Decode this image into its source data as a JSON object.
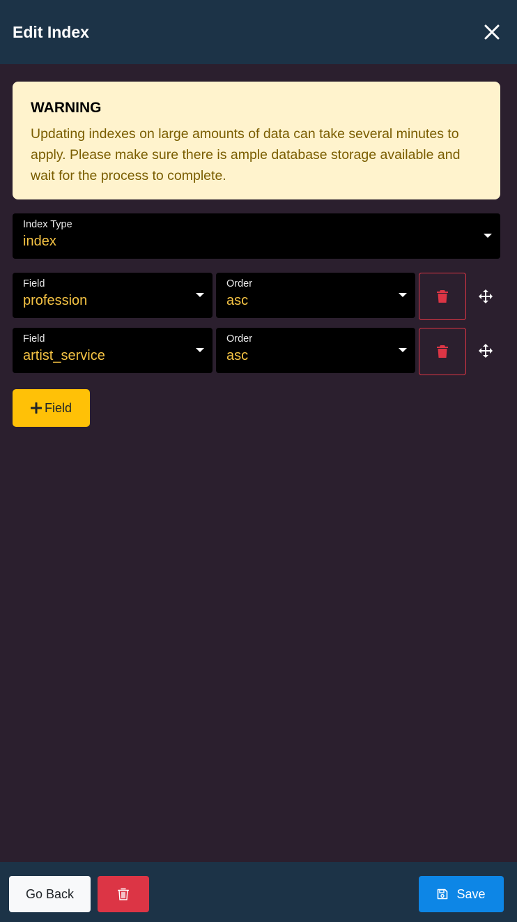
{
  "header": {
    "title": "Edit Index",
    "close_icon": "close-icon"
  },
  "warning": {
    "title": "WARNING",
    "text": "Updating indexes on large amounts of data can take several minutes to apply. Please make sure there is ample database storage available and wait for the process to complete."
  },
  "index_type": {
    "label": "Index Type",
    "value": "index"
  },
  "fields": [
    {
      "field_label": "Field",
      "field_value": "profession",
      "order_label": "Order",
      "order_value": "asc"
    },
    {
      "field_label": "Field",
      "field_value": "artist_service",
      "order_label": "Order",
      "order_value": "asc"
    }
  ],
  "add_field": {
    "label": "Field",
    "icon": "plus-icon"
  },
  "footer": {
    "go_back_label": "Go Back",
    "delete_icon": "trash-icon",
    "save_label": "Save",
    "save_icon": "floppy-disk-icon"
  },
  "colors": {
    "header_bg": "#1c3347",
    "page_bg": "#2b1f2e",
    "warning_bg": "#fff3cd",
    "warning_text": "#7a5d00",
    "select_value": "#f5c344",
    "danger": "#dc3545",
    "add_button": "#ffc107",
    "save_button": "#0d86e6"
  }
}
